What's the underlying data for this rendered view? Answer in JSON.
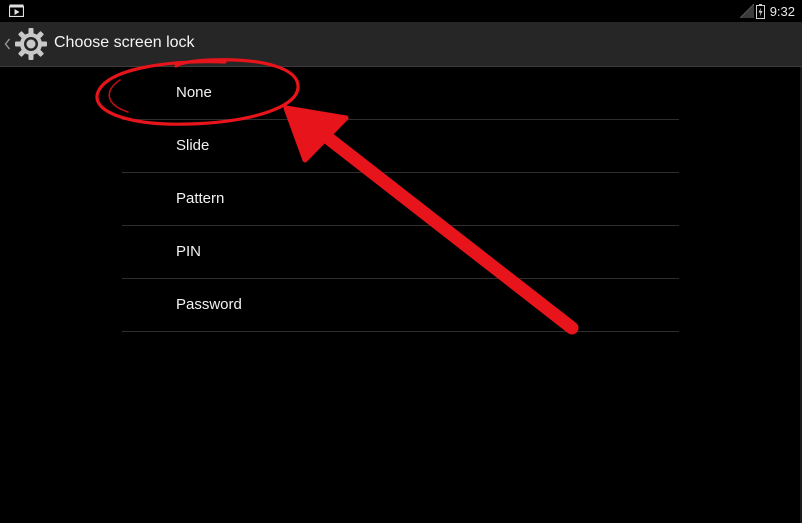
{
  "status_bar": {
    "notification_icon": "media-notification-icon",
    "signal_icon": "signal-icon",
    "battery_icon": "battery-icon",
    "time": "9:32"
  },
  "action_bar": {
    "back_icon": "chevron-left-icon",
    "app_icon": "settings-gear-icon",
    "title": "Choose screen lock"
  },
  "lock_options": [
    {
      "label": "None"
    },
    {
      "label": "Slide"
    },
    {
      "label": "Pattern"
    },
    {
      "label": "PIN"
    },
    {
      "label": "Password"
    }
  ],
  "annotation": {
    "color": "#e8141b",
    "circle_target": "None",
    "arrow_icon": "red-arrow-annotation"
  },
  "colors": {
    "background": "#000000",
    "action_bar": "#262626",
    "divider": "#2e2e2e",
    "text": "#f2f2f2"
  }
}
